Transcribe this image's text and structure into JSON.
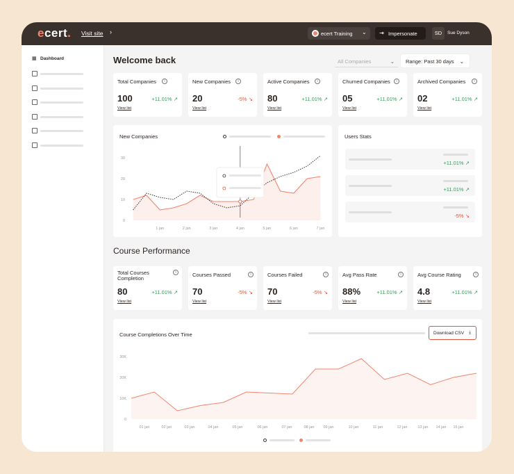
{
  "topbar": {
    "logo": "ecert.",
    "visit_site": "Visit site",
    "org": "ecert Training",
    "impersonate": "Impersonate",
    "avatar": "SD",
    "user": "Sue Dyson"
  },
  "sidebar": {
    "items": [
      {
        "label": "Dashboard"
      }
    ]
  },
  "header": {
    "title": "Welcome back",
    "companies_filter": "All Companies",
    "range_filter": "Range: Past 30 days"
  },
  "stats": [
    {
      "title": "Total Companies",
      "value": "100",
      "delta": "+11.01%",
      "link": "View list",
      "trend": "up"
    },
    {
      "title": "New Companies",
      "value": "20",
      "delta": "-5%",
      "link": "View list",
      "trend": "down"
    },
    {
      "title": "Active Companies",
      "value": "80",
      "delta": "+11.01%",
      "link": "View list",
      "trend": "up"
    },
    {
      "title": "Churned Companies",
      "value": "05",
      "delta": "+11.01%",
      "link": "View list",
      "trend": "up"
    },
    {
      "title": "Archived Companies",
      "value": "02",
      "delta": "+11.01%",
      "link": "View list",
      "trend": "up"
    }
  ],
  "new_companies_chart": {
    "title": "New Companies"
  },
  "users_stats": {
    "title": "Users Stats",
    "rows": [
      {
        "delta": "+11.01%",
        "trend": "up"
      },
      {
        "delta": "+11.01%",
        "trend": "up"
      },
      {
        "delta": "-5%",
        "trend": "down"
      }
    ]
  },
  "course_performance": {
    "title": "Course Performance",
    "stats": [
      {
        "title": "Total Courses Completion",
        "value": "80",
        "delta": "+11.01%",
        "link": "View list",
        "trend": "up"
      },
      {
        "title": "Courses Passed",
        "value": "70",
        "delta": "-5%",
        "link": "View list",
        "trend": "down"
      },
      {
        "title": "Courses Failed",
        "value": "70",
        "delta": "-5%",
        "link": "View list",
        "trend": "down"
      },
      {
        "title": "Avg Pass Rate",
        "value": "88%",
        "delta": "+11.01%",
        "link": "View list",
        "trend": "up"
      },
      {
        "title": "Avg Course Rating",
        "value": "4.8",
        "delta": "+11.01%",
        "link": "View list",
        "trend": "up"
      }
    ]
  },
  "completions_chart": {
    "title": "Course Completions Over Time",
    "download": "Download CSV"
  },
  "chart_data": [
    {
      "type": "line",
      "title": "New Companies",
      "categories": [
        "1 jan",
        "2 jan",
        "3 jan",
        "4 jan",
        "5 jan",
        "6 jan",
        "7 jan"
      ],
      "y_ticks": [
        "0",
        "10",
        "20",
        "30"
      ],
      "ylim": [
        0,
        30
      ],
      "x": [
        0,
        0.5,
        1,
        1.5,
        2,
        2.5,
        3,
        3.5,
        4,
        4.5,
        5,
        5.5,
        6,
        6.5,
        7
      ],
      "series": [
        {
          "style": "solid",
          "color": "#f2846e",
          "values": [
            10,
            12,
            5,
            6,
            8,
            12,
            9,
            9,
            9,
            10,
            27,
            14,
            13,
            20,
            21
          ]
        },
        {
          "style": "dotted",
          "color": "#3a302c",
          "values": [
            5,
            13,
            11,
            10,
            14,
            13,
            8,
            6,
            7,
            13,
            18,
            21,
            23,
            26,
            31
          ]
        }
      ],
      "grid": false
    },
    {
      "type": "area",
      "title": "Course Completions Over Time",
      "categories": [
        "01 jan",
        "02 jan",
        "03 jan",
        "04 jan",
        "05 jan",
        "06 jan",
        "07 jan",
        "08 jan",
        "09 jan",
        "10 jan",
        "11 jan",
        "12 jan",
        "13 jan",
        "14 jan",
        "15 jan"
      ],
      "y_ticks": [
        "0",
        "10K",
        "20K",
        "30K"
      ],
      "ylim": [
        0,
        30000
      ],
      "values": [
        10000,
        13000,
        4000,
        6500,
        8000,
        13000,
        12500,
        12000,
        24000,
        24000,
        29000,
        19000,
        22000,
        16500,
        20000,
        22000
      ],
      "color": "#f2846e",
      "grid": false
    }
  ]
}
